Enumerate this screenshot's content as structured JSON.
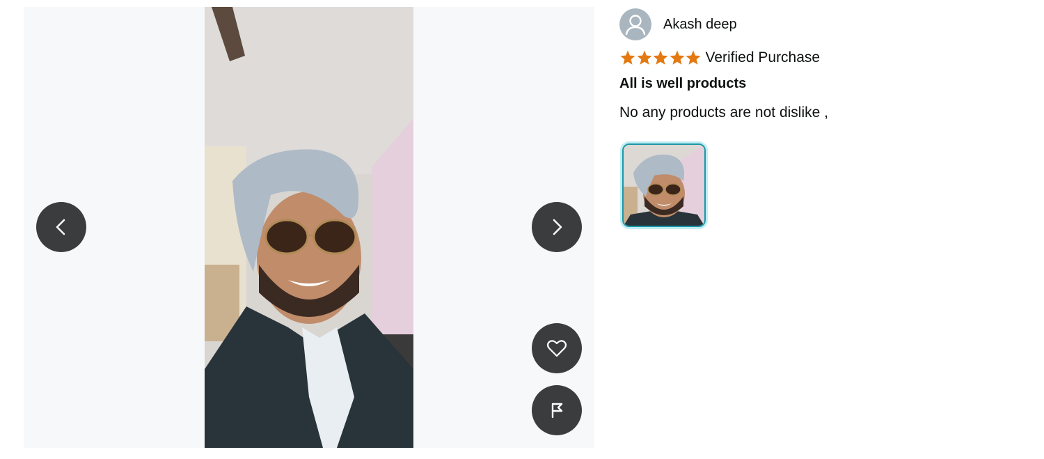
{
  "viewer": {
    "prev_icon": "chevron-left-icon",
    "next_icon": "chevron-right-icon",
    "like_icon": "heart-icon",
    "report_icon": "flag-icon",
    "photo_description_icon": "customer-photo"
  },
  "review": {
    "author": "Akash deep",
    "avatar_icon": "user-avatar-icon",
    "rating": 5,
    "rating_max": 5,
    "verified_label": "Verified Purchase",
    "title": "All is well products",
    "body": "No any products are not dislike ,"
  },
  "colors": {
    "star": "#e47911",
    "button": "#3a3c3e",
    "viewer_bg": "#f7f8fa",
    "thumb_border": "#1c96a8"
  }
}
